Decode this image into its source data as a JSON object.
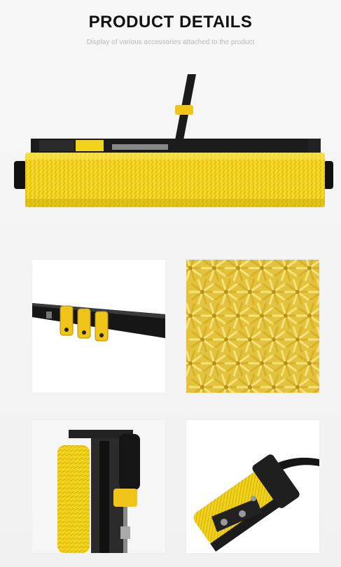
{
  "header": {
    "title": "PRODUCT DETAILS",
    "subtitle": "Display of various accessories attached to the product"
  },
  "colors": {
    "bristle_yellow": "#f2d21b",
    "bristle_shadow": "#d8b60f",
    "frame_black": "#1b1b1b",
    "background": "#f4f4f4"
  }
}
